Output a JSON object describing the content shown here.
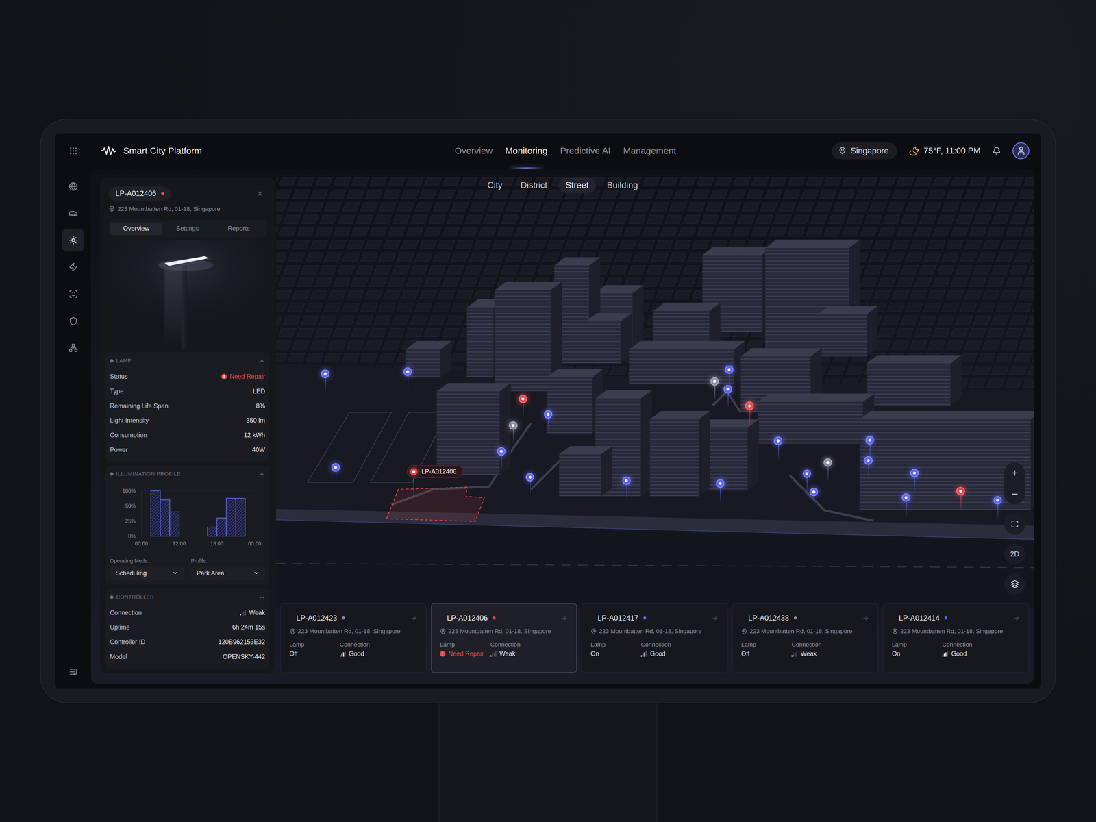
{
  "header": {
    "title": "Smart City Platform",
    "nav": [
      {
        "label": "Overview",
        "selected": false
      },
      {
        "label": "Monitoring",
        "selected": true
      },
      {
        "label": "Predictive AI",
        "selected": false
      },
      {
        "label": "Management",
        "selected": false
      }
    ],
    "location": "Singapore",
    "weather": "75°F, 11:00 PM"
  },
  "sidebar": {
    "items": [
      {
        "selected": false
      },
      {
        "selected": false
      },
      {
        "selected": true
      },
      {
        "selected": false
      },
      {
        "selected": false
      },
      {
        "selected": false
      },
      {
        "selected": false
      }
    ]
  },
  "detail": {
    "id": "LP-A012406",
    "status_color": "#e5484d",
    "address": "223 Mountbatten Rd, 01-18, Singapore",
    "tabs": [
      {
        "label": "Overview",
        "selected": true
      },
      {
        "label": "Settings",
        "selected": false
      },
      {
        "label": "Reports",
        "selected": false
      }
    ],
    "lamp": {
      "title": "LAMP",
      "expanded": true,
      "rows": [
        {
          "label": "Status",
          "value": "Need Repair",
          "kind": "status",
          "color": "#e5484d"
        },
        {
          "label": "Type",
          "value": "LED",
          "kind": "text"
        },
        {
          "label": "Remaining Life Span",
          "value": "8%",
          "kind": "text"
        },
        {
          "label": "Light Intensity",
          "value": "350 lm",
          "kind": "text"
        },
        {
          "label": "Consumption",
          "value": "12 kWh",
          "kind": "text"
        },
        {
          "label": "Power",
          "value": "40W",
          "kind": "text"
        }
      ]
    },
    "profile": {
      "title": "ILLUMINATION PROFILE",
      "expanded": true,
      "chart": {
        "y_ticks": [
          "100%",
          "50%",
          "25%",
          "0%"
        ],
        "x_ticks": [
          "00:00",
          "12:00",
          "18:00",
          "00:00"
        ],
        "values": [
          0,
          100,
          70,
          40,
          0,
          0,
          0,
          15,
          30,
          75,
          75,
          0
        ]
      },
      "fields": [
        {
          "label": "Operating Mode:",
          "value": "Scheduling"
        },
        {
          "label": "Profile:",
          "value": "Park Area"
        }
      ]
    },
    "controller": {
      "title": "CONTROLLER",
      "expanded": true,
      "rows": [
        {
          "label": "Connection",
          "value": "Weak",
          "kind": "signal",
          "level": 0.25
        },
        {
          "label": "Uptime",
          "value": "6h 24m 15s",
          "kind": "text"
        },
        {
          "label": "Controller ID",
          "value": "120B962153E32",
          "kind": "text"
        },
        {
          "label": "Model",
          "value": "OPENSKY-442",
          "kind": "text"
        }
      ]
    }
  },
  "map": {
    "views": [
      {
        "label": "City",
        "selected": false
      },
      {
        "label": "District",
        "selected": false
      },
      {
        "label": "Street",
        "selected": true
      },
      {
        "label": "Building",
        "selected": false
      }
    ],
    "mode_button": "2D",
    "pins": [
      {
        "color": "#5b64f0"
      },
      {
        "color": "#5b64f0"
      },
      {
        "color": "#5b64f0"
      },
      {
        "color": "#5b64f0"
      },
      {
        "color": "#8a8ea3"
      },
      {
        "color": "#5b64f0"
      },
      {
        "color": "#5b64f0"
      },
      {
        "color": "#5b64f0"
      },
      {
        "color": "#5b64f0"
      },
      {
        "color": "#5b64f0"
      },
      {
        "color": "#8a8ea3"
      },
      {
        "color": "#5b64f0"
      },
      {
        "color": "#5b64f0"
      },
      {
        "color": "#5b64f0"
      },
      {
        "color": "#5b64f0"
      },
      {
        "color": "#8a8ea3"
      },
      {
        "color": "#5b64f0"
      },
      {
        "color": "#5b64f0"
      },
      {
        "color": "#5b64f0"
      },
      {
        "color": "#5b64f0"
      },
      {
        "color": "#5b64f0"
      },
      {
        "color": "#e5484d"
      },
      {
        "color": "#e5484d"
      },
      {
        "color": "#e5484d"
      },
      {
        "color": "#e5484d",
        "label": "LP-A012406"
      }
    ]
  },
  "cards": [
    {
      "id": "LP-A012423",
      "dot_color": "#8b8d98",
      "address": "223 Mountbatten Rd, 01-18, Singapore",
      "lamp_label": "Lamp",
      "lamp": "Off",
      "lamp_alert": false,
      "connection_label": "Connection",
      "connection": "Good",
      "level": 0.75,
      "selected": false
    },
    {
      "id": "LP-A012406",
      "dot_color": "#e5484d",
      "address": "223 Mountbatten Rd, 01-18, Singapore",
      "lamp_label": "Lamp",
      "lamp": "Need Repair",
      "lamp_alert": true,
      "connection_label": "Connection",
      "connection": "Weak",
      "level": 0.25,
      "selected": true
    },
    {
      "id": "LP-A012417",
      "dot_color": "#5b64f0",
      "address": "223 Mountbatten Rd, 01-18, Singapore",
      "lamp_label": "Lamp",
      "lamp": "On",
      "lamp_alert": false,
      "connection_label": "Connection",
      "connection": "Good",
      "level": 0.75,
      "selected": false
    },
    {
      "id": "LP-A012438",
      "dot_color": "#8b8d98",
      "address": "223 Mountbatten Rd, 01-18, Singapore",
      "lamp_label": "Lamp",
      "lamp": "Off",
      "lamp_alert": false,
      "connection_label": "Connection",
      "connection": "Weak",
      "level": 0.25,
      "selected": false
    },
    {
      "id": "LP-A012414",
      "dot_color": "#5b64f0",
      "address": "223 Mountbatten Rd, 01-18, Singapore",
      "lamp_label": "Lamp",
      "lamp": "On",
      "lamp_alert": false,
      "connection_label": "Connection",
      "connection": "Good",
      "level": 0.75,
      "selected": false
    }
  ]
}
